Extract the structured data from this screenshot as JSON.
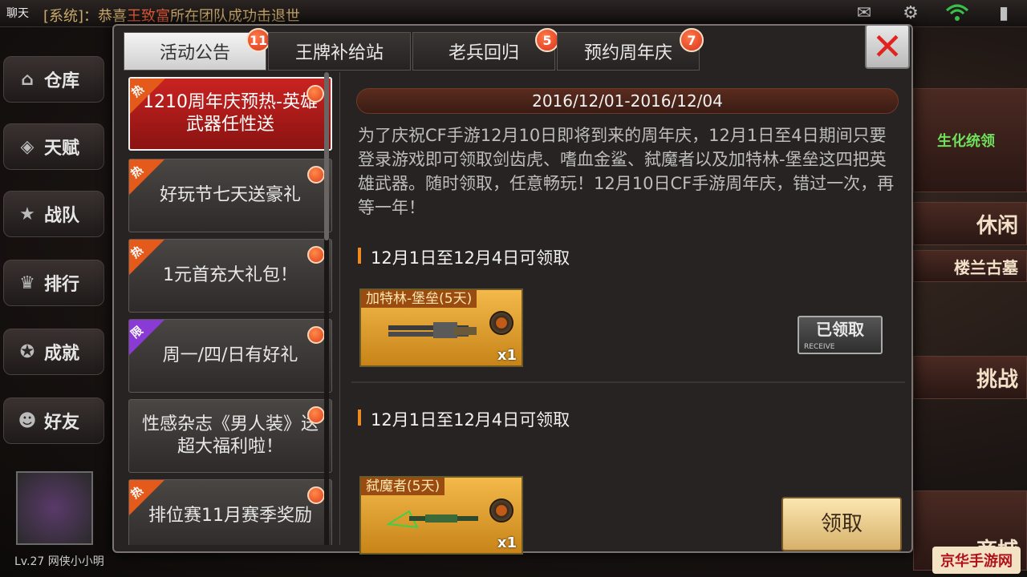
{
  "top_bar": {
    "chat_label": "聊天",
    "system_message_prefix": "[系统]：",
    "system_message_text": "恭喜",
    "system_message_name": "王致富",
    "system_message_suffix": "所在团队成功击退世"
  },
  "left_nav": {
    "items": [
      {
        "label": "仓库",
        "icon": "warehouse-icon"
      },
      {
        "label": "天赋",
        "icon": "talent-icon"
      },
      {
        "label": "战队",
        "icon": "team-icon"
      },
      {
        "label": "排行",
        "icon": "ranking-icon"
      },
      {
        "label": "成就",
        "icon": "achievement-icon"
      },
      {
        "label": "好友",
        "icon": "friends-icon"
      }
    ]
  },
  "right_panel": {
    "cards": [
      "生化统领",
      "休闲",
      "楼兰古墓",
      "挑战",
      "商城"
    ]
  },
  "player": {
    "level": "Lv.27",
    "name": "网侠小小明"
  },
  "dialog": {
    "tabs": [
      {
        "label": "活动公告",
        "badge": "11",
        "active": true
      },
      {
        "label": "王牌补给站",
        "badge": "",
        "active": false
      },
      {
        "label": "老兵回归",
        "badge": "5",
        "active": false
      },
      {
        "label": "预约周年庆",
        "badge": "7",
        "active": false
      }
    ],
    "list": [
      {
        "title": "1210周年庆预热-英雄武器任性送",
        "tag": "热",
        "tag_color": "#e35a1a",
        "active": true
      },
      {
        "title": "好玩节七天送豪礼",
        "tag": "热",
        "tag_color": "#e35a1a",
        "active": false
      },
      {
        "title": "1元首充大礼包！",
        "tag": "热",
        "tag_color": "#e35a1a",
        "active": false
      },
      {
        "title": "周一/四/日有好礼",
        "tag": "限",
        "tag_color": "#8a3bd6",
        "active": false
      },
      {
        "title": "性感杂志《男人装》送超大福利啦！",
        "tag": "",
        "tag_color": "",
        "active": false
      },
      {
        "title": "排位赛11月赛季奖励",
        "tag": "热",
        "tag_color": "#e35a1a",
        "active": false
      }
    ],
    "content": {
      "date_range": "2016/12/01-2016/12/04",
      "description": "为了庆祝CF手游12月10日即将到来的周年庆，12月1日至4日期间只要登录游戏即可领取剑齿虎、嗜血金鲨、弑魔者以及加特林-堡垒这四把英雄武器。随时领取，任意畅玩！12月10日CF手游周年庆，错过一次，再等一年！",
      "rewards": [
        {
          "condition": "12月1日至12月4日可领取",
          "item_name": "加特林-堡垒(5天)",
          "quantity": "x1",
          "status_label": "已领取",
          "status_sub": "RECEIVE",
          "claimed": true
        },
        {
          "condition": "12月1日至12月4日可领取",
          "item_name": "弑魔者(5天)",
          "quantity": "x1",
          "status_label": "领取",
          "claimed": false
        }
      ]
    }
  },
  "corner_watermark": "京华手游网",
  "colors": {
    "accent_orange": "#f08a1c",
    "hot_tag": "#e35a1a",
    "limited_tag": "#8a3bd6",
    "active_item": "#c92321",
    "close_x": "#e0231e"
  }
}
